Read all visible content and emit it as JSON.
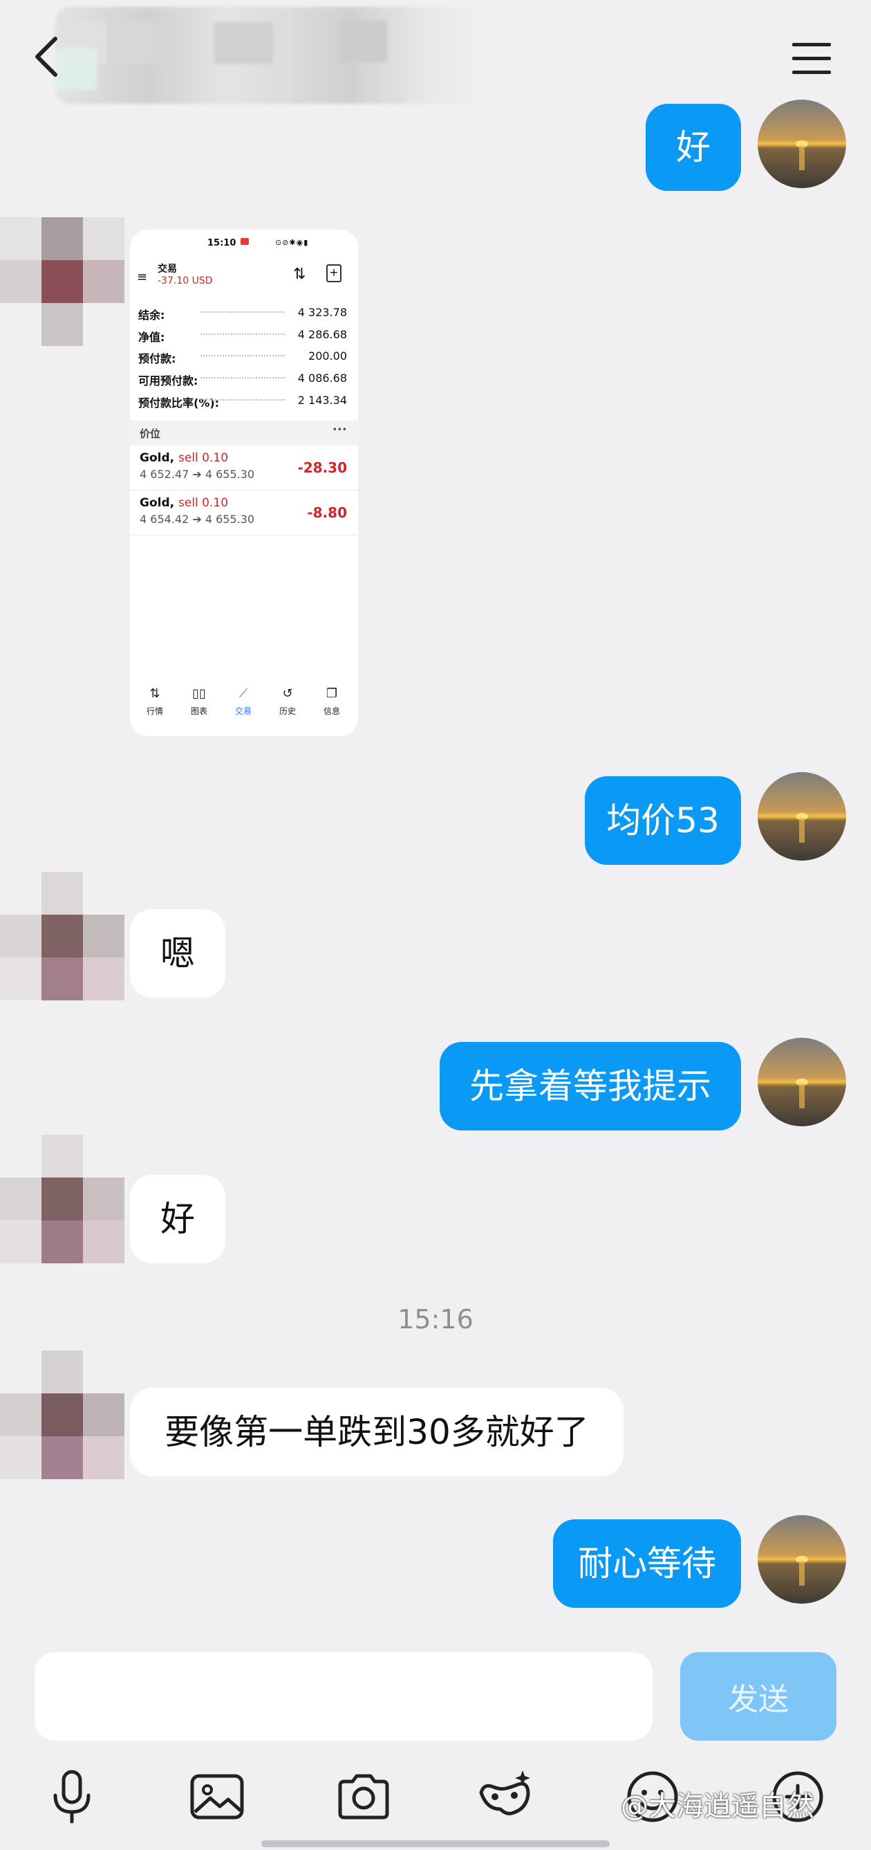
{
  "header": {
    "back_icon": "chevron-left-icon",
    "menu_icon": "hamburger-menu-icon"
  },
  "messages": {
    "m1": "好",
    "m3": "均价53",
    "m4": "嗯",
    "m5": "先拿着等我提示",
    "m6": "好",
    "time_separator": "15:16",
    "m7": "要像第一单跌到30多就好了",
    "m8": "耐心等待"
  },
  "screenshot": {
    "status_time": "15:10",
    "title": "交易",
    "pnl": "-37.10 USD",
    "rows": [
      {
        "label": "结余:",
        "value": "4 323.78"
      },
      {
        "label": "净值:",
        "value": "4 286.68"
      },
      {
        "label": "预付款:",
        "value": "200.00"
      },
      {
        "label": "可用预付款:",
        "value": "4 086.68"
      },
      {
        "label": "预付款比率(%):",
        "value": "2 143.34"
      }
    ],
    "section": "价位",
    "section_more": "•••",
    "positions": [
      {
        "symbol": "Gold,",
        "side": "sell 0.10",
        "range": "4 652.47 ➔ 4 655.30",
        "pl": "-28.30"
      },
      {
        "symbol": "Gold,",
        "side": "sell 0.10",
        "range": "4 654.42 ➔ 4 655.30",
        "pl": "-8.80"
      }
    ],
    "nav": [
      "行情",
      "图表",
      "交易",
      "历史",
      "信息"
    ]
  },
  "composer": {
    "input_value": "",
    "send_label": "发送",
    "tools": [
      "microphone-icon",
      "image-icon",
      "camera-icon",
      "mask-sparkle-icon",
      "emoji-icon",
      "add-circle-icon"
    ]
  },
  "watermark": "@大海逍遥自然",
  "colors": {
    "outgoing_bubble": "#0a99f5",
    "incoming_bubble": "#ffffff",
    "background": "#f0f0f2",
    "send_button": "#7fc6f7",
    "loss_red": "#d0262b"
  }
}
